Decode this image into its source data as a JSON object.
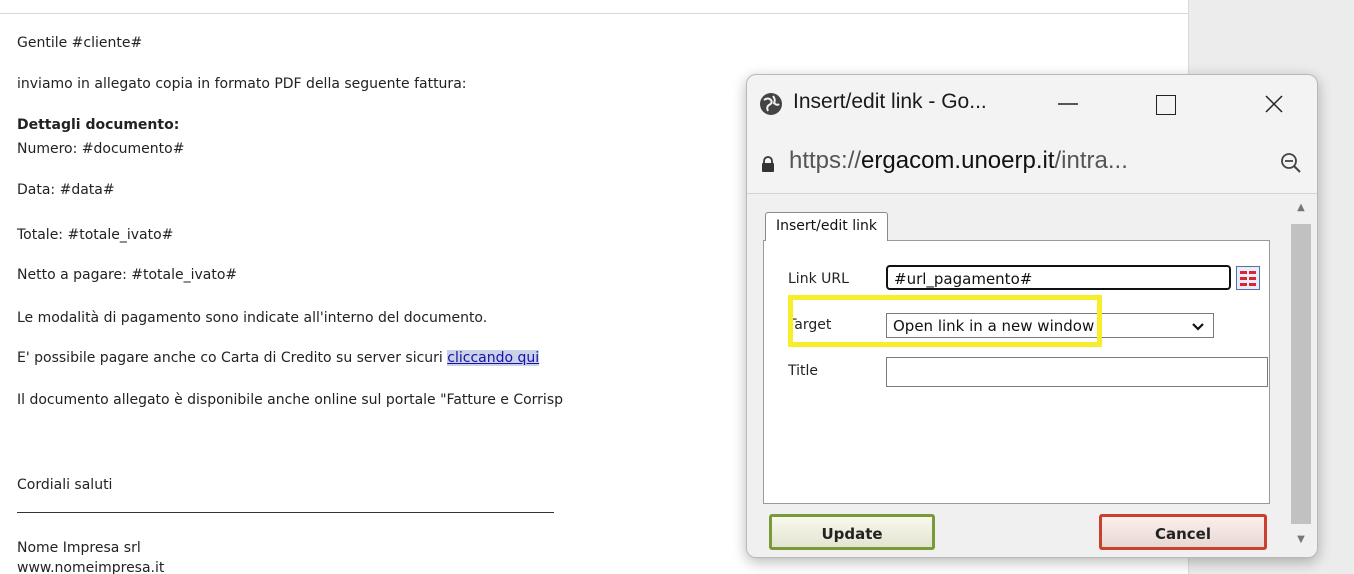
{
  "email": {
    "greeting": "Gentile #cliente#",
    "intro": "inviamo in allegato copia in formato PDF della seguente fattura:",
    "details_heading": "Dettagli documento:",
    "numero": "Numero: #documento#",
    "data": "Data: #data#",
    "totale": "Totale: #totale_ivato#",
    "netto": "Netto a pagare: #totale_ivato#",
    "modalita": "Le modalità di pagamento sono indicate all'interno del documento.",
    "pay_text": "E' possibile pagare anche co  Carta di Credito su server sicuri ",
    "pay_link": "cliccando qui",
    "online": "Il documento allegato è disponibile anche online sul portale \"Fatture e Corrisp",
    "closing": "Cordiali saluti",
    "company": "Nome Impresa srl",
    "website": "www.nomeimpresa.it"
  },
  "popup": {
    "window_title": "Insert/edit link - Go...",
    "url_prefix": "https://",
    "url_host": "ergacom.unoerp.it",
    "url_suffix": "/intra...",
    "tab_label": "Insert/edit link",
    "link_url_label": "Link URL",
    "link_url_value": "#url_pagamento#",
    "target_label": "Target",
    "target_value": "Open link in a new window",
    "title_label": "Title",
    "title_value": "",
    "update_label": "Update",
    "cancel_label": "Cancel"
  },
  "colors": {
    "highlight": "#f6ee2a",
    "link": "#1a0dab",
    "update_border": "#7a9a3a",
    "cancel_border": "#c8402e"
  }
}
